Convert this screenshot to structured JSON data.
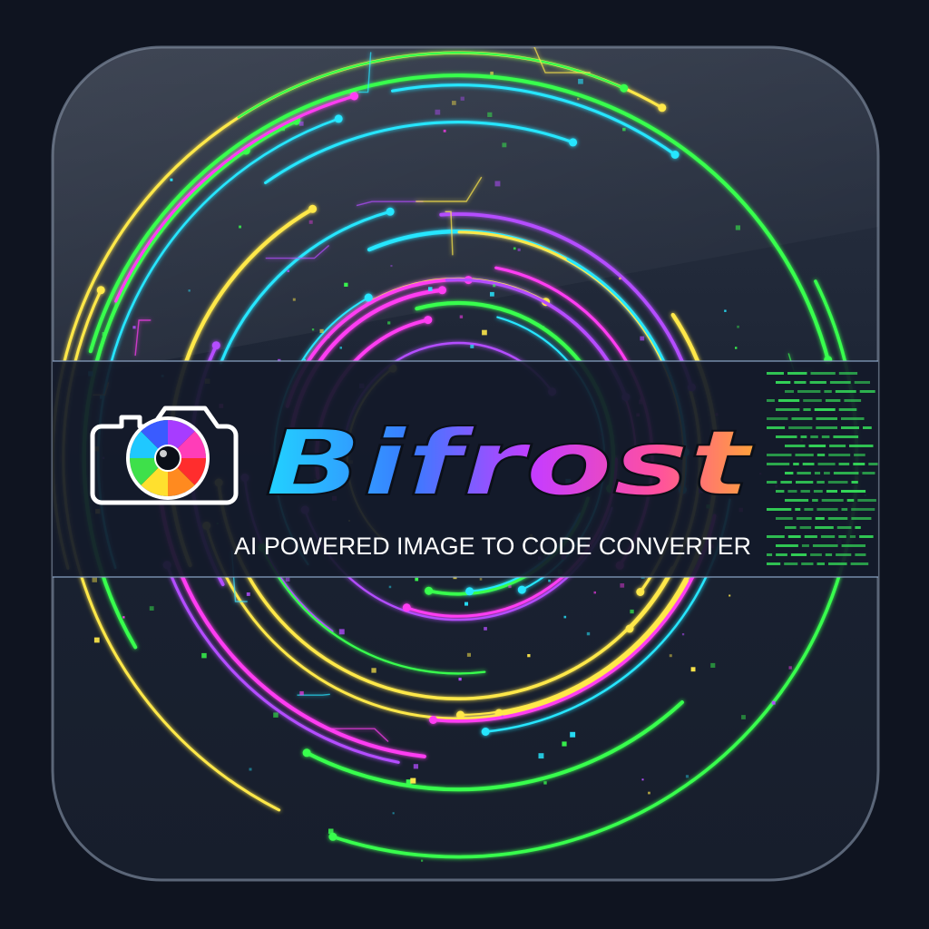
{
  "brand": {
    "name": "Bifrost",
    "tagline": "AI POWERED IMAGE TO CODE CONVERTER"
  },
  "icons": {
    "logo": "camera-icon"
  },
  "colors": {
    "background": "#0f1420",
    "tile": "#1a2232",
    "band": "#131a2a",
    "neon": [
      "#ff3df2",
      "#27e6ff",
      "#ffe84a",
      "#39ff4e",
      "#b44dff"
    ],
    "code": "#35e05a"
  }
}
